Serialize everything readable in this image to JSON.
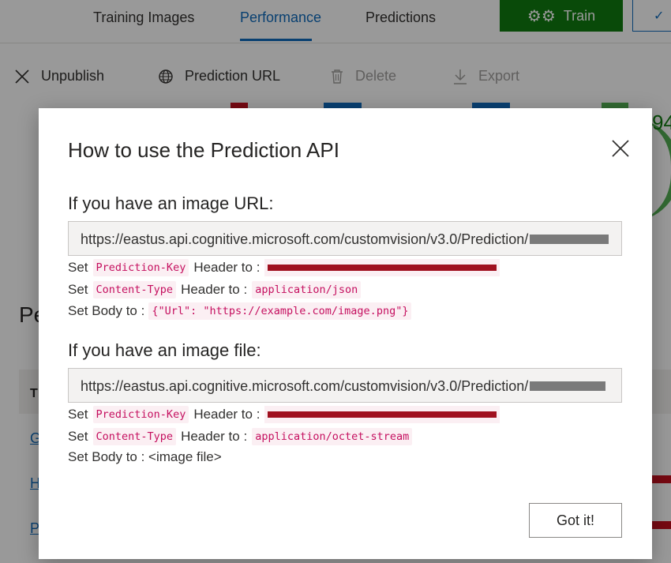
{
  "tabs": [
    {
      "label": "Training Images",
      "active": false
    },
    {
      "label": "Performance",
      "active": true
    },
    {
      "label": "Predictions",
      "active": false
    }
  ],
  "train_button": {
    "label": "Train",
    "icon": "gears-icon",
    "color": "#107c10"
  },
  "split_button": {
    "label": "✓"
  },
  "toolbar": {
    "unpublish": {
      "label": "Unpublish",
      "icon": "close-icon"
    },
    "prediction_url": {
      "label": "Prediction URL",
      "icon": "globe-icon"
    },
    "delete": {
      "label": "Delete",
      "icon": "trash-icon",
      "disabled": true
    },
    "export": {
      "label": "Export",
      "icon": "download-icon",
      "disabled": true
    }
  },
  "background": {
    "metric_value": "94",
    "heading": "Pe",
    "table_header": "T",
    "links": [
      "G",
      "H",
      "P"
    ]
  },
  "dialog": {
    "title": "How to use the Prediction API",
    "url_section": {
      "heading": "If you have an image URL:",
      "endpoint": "https://eastus.api.cognitive.microsoft.com/customvision/v3.0/Prediction/",
      "key_line": {
        "prefix": "Set",
        "code": "Prediction-Key",
        "suffix": "Header to :"
      },
      "type_line": {
        "prefix": "Set",
        "code": "Content-Type",
        "suffix": "Header to :",
        "value": "application/json"
      },
      "body_line": {
        "prefix": "Set Body to :",
        "value": "{\"Url\": \"https://example.com/image.png\"}"
      }
    },
    "file_section": {
      "heading": "If you have an image file:",
      "endpoint": "https://eastus.api.cognitive.microsoft.com/customvision/v3.0/Prediction/",
      "key_line": {
        "prefix": "Set",
        "code": "Prediction-Key",
        "suffix": "Header to :"
      },
      "type_line": {
        "prefix": "Set",
        "code": "Content-Type",
        "suffix": "Header to :",
        "value": "application/octet-stream"
      },
      "body_line": {
        "text": "Set Body to : <image file>"
      }
    },
    "got_it_label": "Got it!",
    "close_icon": "close-icon"
  }
}
